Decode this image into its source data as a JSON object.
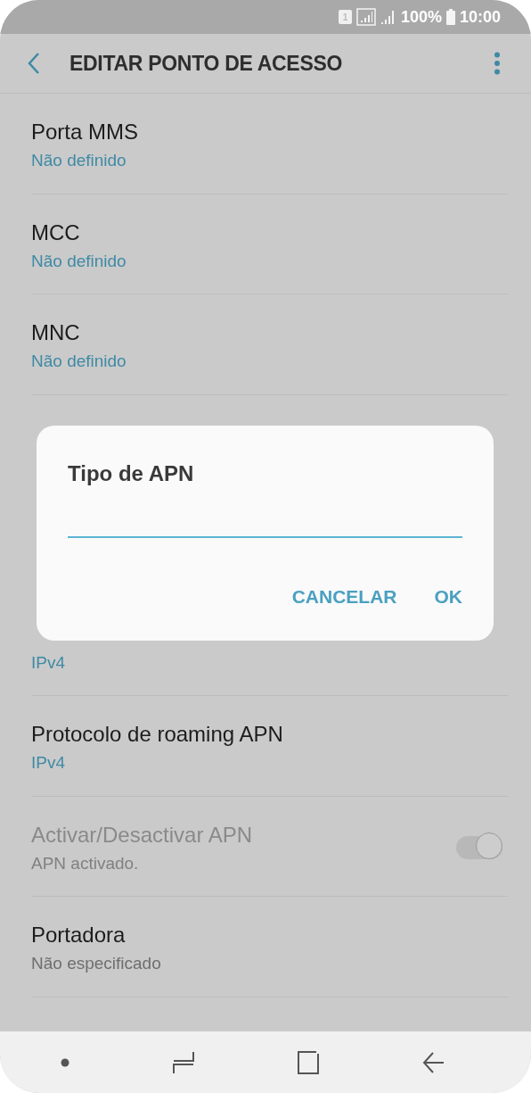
{
  "status_bar": {
    "sim_label": "1",
    "battery": "100%",
    "time": "10:00"
  },
  "header": {
    "title": "EDITAR PONTO DE ACESSO"
  },
  "settings_top": [
    {
      "kind": "choice",
      "label": "Porta MMS",
      "value": "Não definido",
      "disabled": false
    },
    {
      "kind": "choice",
      "label": "MCC",
      "value": "Não definido",
      "disabled": false
    },
    {
      "kind": "choice",
      "label": "MNC",
      "value": "Não definido",
      "disabled": false
    }
  ],
  "dialog": {
    "title": "Tipo de APN",
    "buttons": [
      "CANCELAR",
      "OK"
    ]
  },
  "settings_bottom": [
    {
      "kind": "choice",
      "value": "IPv4"
    },
    {
      "kind": "choice",
      "label": "Protocolo de roaming APN",
      "value": "IPv4",
      "disabled": false
    },
    {
      "kind": "switch",
      "label": "Activar/Desactivar APN",
      "value": "APN activado.",
      "disabled": true,
      "on": true
    },
    {
      "kind": "text",
      "label": "Portadora",
      "value": "Não especificado",
      "disabled": false
    }
  ]
}
